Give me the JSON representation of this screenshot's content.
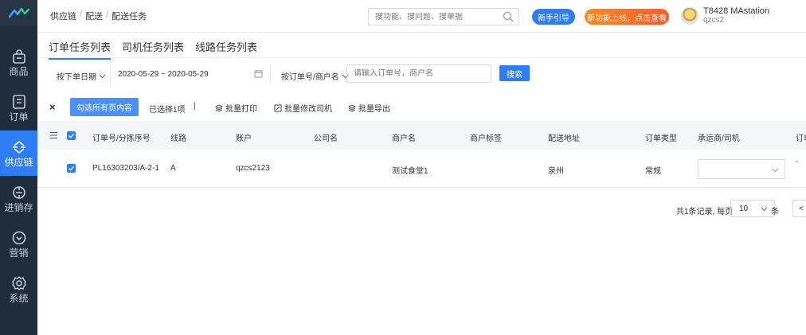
{
  "sidebar": {
    "items": [
      {
        "label": "商品",
        "icon": "bag-icon"
      },
      {
        "label": "订单",
        "icon": "doc-icon"
      },
      {
        "label": "供应链",
        "icon": "supply-icon"
      },
      {
        "label": "进销存",
        "icon": "warehouse-icon"
      },
      {
        "label": "营销",
        "icon": "marketing-icon"
      },
      {
        "label": "系统",
        "icon": "gear-icon"
      }
    ],
    "active_index": 2
  },
  "header": {
    "breadcrumb": [
      "供应链",
      "配送",
      "配送任务"
    ],
    "search_placeholder": "搜功能、搜问题、搜单据",
    "guide_button": "新手引导",
    "new_feature_button": "新功能上线，点击查看",
    "user_name": "T8428 MAstation",
    "user_sub": "qzcs2"
  },
  "tabs": [
    "订单任务列表",
    "司机任务列表",
    "线路任务列表"
  ],
  "filter": {
    "date_select": "按下单日期",
    "date_range": "2020-05-29 ~ 2020-05-29",
    "keyword_select": "按订单号/商户名",
    "keyword_placeholder": "请输入订单号，商户名",
    "search_button": "搜索"
  },
  "actions": {
    "close": "×",
    "select_all_pages": "勾选所有页内容",
    "selected_count": "已选择1项",
    "separator": "|",
    "batch_print": "批量打印",
    "batch_change_driver": "批量修改司机",
    "batch_export": "批量导出"
  },
  "table": {
    "headers": [
      "订单号/分拣序号",
      "线路",
      "账户",
      "公司名",
      "商户名",
      "商户标签",
      "配送地址",
      "订单类型",
      "承运商/司机",
      "订单"
    ],
    "rows": [
      {
        "order_no": "PL16303203/A-2-1",
        "route": "A",
        "account": "qzcs2123",
        "company": "",
        "merchant": "测试食堂1",
        "merchant_tag": "",
        "address": "泉州",
        "order_type": "常规",
        "carrier": "",
        "extra": "-"
      }
    ]
  },
  "pagination": {
    "summary": "共1条记录, 每页",
    "page_size": "10",
    "unit": "条",
    "prev": "<"
  },
  "colors": {
    "primary": "#2e7df5",
    "sidebar": "#1f2d3d",
    "orange": "#ff6a25"
  }
}
